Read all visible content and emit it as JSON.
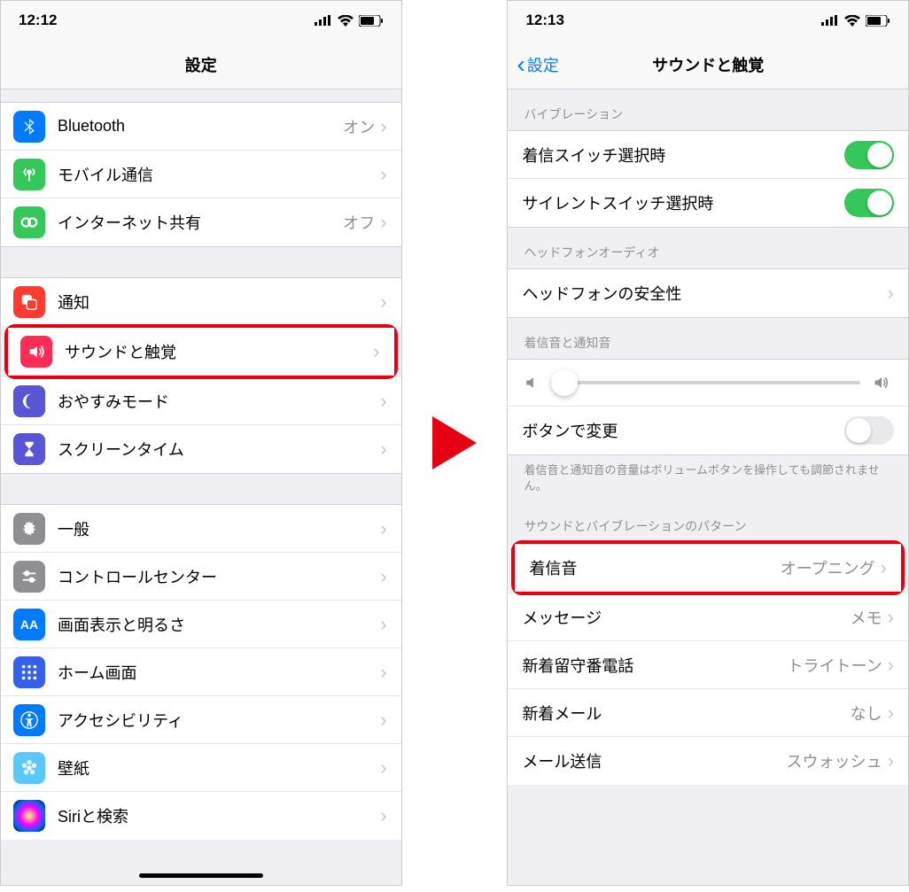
{
  "left": {
    "time": "12:12",
    "title": "設定",
    "rows": {
      "bluetooth": {
        "label": "Bluetooth",
        "value": "オン"
      },
      "mobile": {
        "label": "モバイル通信"
      },
      "hotspot": {
        "label": "インターネット共有",
        "value": "オフ"
      },
      "notifications": {
        "label": "通知"
      },
      "sounds": {
        "label": "サウンドと触覚"
      },
      "dnd": {
        "label": "おやすみモード"
      },
      "screentime": {
        "label": "スクリーンタイム"
      },
      "general": {
        "label": "一般"
      },
      "control": {
        "label": "コントロールセンター"
      },
      "display": {
        "label": "画面表示と明るさ"
      },
      "home": {
        "label": "ホーム画面"
      },
      "accessibility": {
        "label": "アクセシビリティ"
      },
      "wallpaper": {
        "label": "壁紙"
      },
      "siri": {
        "label": "Siriと検索"
      }
    }
  },
  "right": {
    "time": "12:13",
    "back": "設定",
    "title": "サウンドと触覚",
    "sections": {
      "vibration": {
        "header": "バイブレーション",
        "ring": "着信スイッチ選択時",
        "silent": "サイレントスイッチ選択時"
      },
      "headphone": {
        "header": "ヘッドフォンオーディオ",
        "safety": "ヘッドフォンの安全性"
      },
      "ringer": {
        "header": "着信音と通知音",
        "button": "ボタンで変更",
        "footer": "着信音と通知音の音量はボリュームボタンを操作しても調節されません。"
      },
      "patterns": {
        "header": "サウンドとバイブレーションのパターン",
        "ringtone": {
          "label": "着信音",
          "value": "オープニング"
        },
        "message": {
          "label": "メッセージ",
          "value": "メモ"
        },
        "voicemail": {
          "label": "新着留守番電話",
          "value": "トライトーン"
        },
        "newmail": {
          "label": "新着メール",
          "value": "なし"
        },
        "sentmail": {
          "label": "メール送信",
          "value": "スウォッシュ"
        }
      }
    }
  }
}
